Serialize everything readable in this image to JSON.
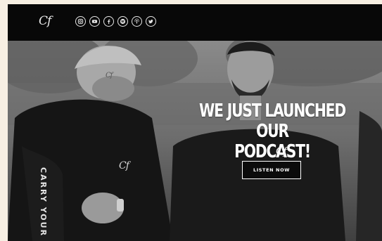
{
  "header": {
    "logo_text": "Cf",
    "social_icons": [
      {
        "name": "instagram-icon"
      },
      {
        "name": "youtube-icon"
      },
      {
        "name": "facebook-icon"
      },
      {
        "name": "spotify-icon"
      },
      {
        "name": "podcast-icon"
      },
      {
        "name": "twitter-icon"
      }
    ]
  },
  "hero": {
    "headline_line1": "WE JUST LAUNCHED OUR",
    "headline_line2": "PODCAST!",
    "signature": "Cf",
    "cta_label": "LISTEN NOW",
    "sleeve_text": "CARRY YOUR",
    "cap_logo": "Cf",
    "chest_logo": "Cf"
  },
  "colors": {
    "topbar": "#080808",
    "page_bg": "#f7efe3",
    "text": "#ffffff"
  }
}
